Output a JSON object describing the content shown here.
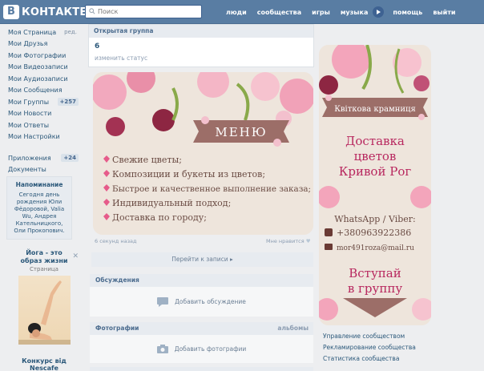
{
  "header": {
    "logo_letter": "В",
    "logo_text": "КОНТАКТЕ",
    "search_placeholder": "Поиск",
    "nav": [
      "люди",
      "сообщества",
      "игры",
      "музыка",
      "помощь",
      "выйти"
    ]
  },
  "sidebar": {
    "items": [
      {
        "label": "Моя Страница",
        "aside": "ред."
      },
      {
        "label": "Мои Друзья"
      },
      {
        "label": "Мои Фотографии"
      },
      {
        "label": "Мои Видеозаписи"
      },
      {
        "label": "Мои Аудиозаписи"
      },
      {
        "label": "Мои Сообщения"
      },
      {
        "label": "Мои Группы",
        "badge": "+257"
      },
      {
        "label": "Мои Новости"
      },
      {
        "label": "Мои Ответы"
      },
      {
        "label": "Мои Настройки"
      }
    ],
    "items2": [
      {
        "label": "Приложения",
        "badge": "+24"
      },
      {
        "label": "Документы"
      }
    ],
    "reminder_title": "Напоминание",
    "reminder_text": "Сегодня день рождения Юли Фёдоровой, Valia Wu, Андрея Кательницкого, Оли Прокопович.",
    "ad_title": "Йога - это образ жизни",
    "ad_sub": "Страница",
    "ad2_title": "Конкурс від Nescafe"
  },
  "main": {
    "group_type": "Открытая группа",
    "group_name": "6",
    "change_status": "изменить статус",
    "post_time": "6 секунд назад",
    "like_text": "Мне нравится",
    "to_posts": "Перейти к записи",
    "discussions_title": "Обсуждения",
    "add_discussion": "Добавить обсуждение",
    "photos_title": "Фотографии",
    "photos_right": "альбомы",
    "add_photos": "Добавить фотографии"
  },
  "menu_image": {
    "title": "МЕНЮ",
    "lines": [
      "Свежие цветы;",
      "Композиции и букеты из цветов;",
      "Быстрое и качественное выполнение заказа;",
      "Индивидуальный подход;",
      "Доставка по городу;"
    ]
  },
  "side_image": {
    "shop_name": "Квіткова крамниця",
    "delivery": [
      "Доставка",
      "цветов",
      "Кривой Рог"
    ],
    "contact_label": "WhatsApp / Viber:",
    "phone": "+380963922386",
    "email": "mor491roza@mail.ru",
    "join": [
      "Вступай",
      "в группу"
    ]
  },
  "manage": [
    "Управление сообществом",
    "Рекламирование сообщества",
    "Статистика сообщества"
  ],
  "colors": {
    "header_bg": "#597da3",
    "page_bg": "#edeef0",
    "link": "#2b587a",
    "menu_banner": "#9c6e68"
  }
}
